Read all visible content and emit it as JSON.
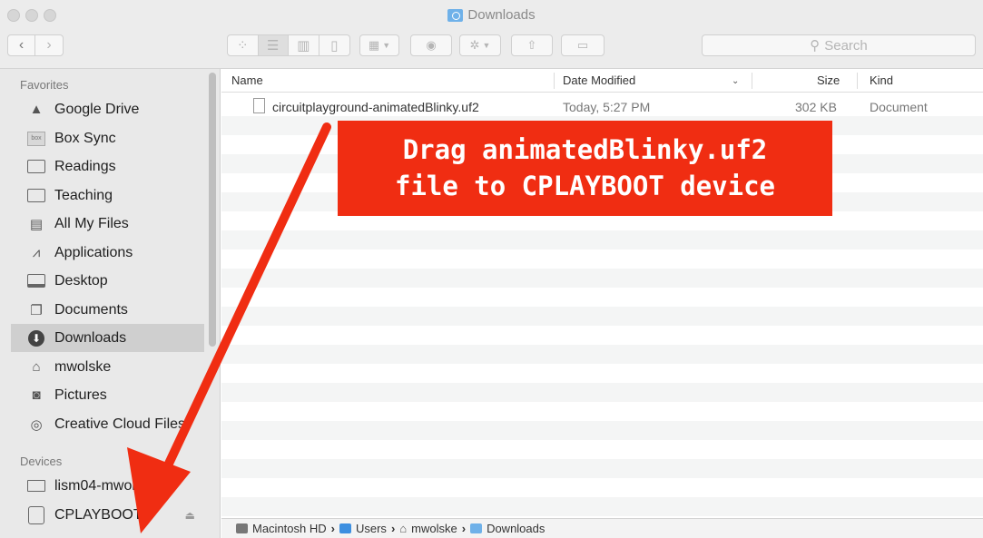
{
  "window": {
    "title": "Downloads"
  },
  "toolbar": {
    "back_icon": "chevron-left-icon",
    "forward_icon": "chevron-right-icon",
    "search_placeholder": "Search"
  },
  "sidebar": {
    "favorites_label": "Favorites",
    "favorites": [
      {
        "label": "Google Drive",
        "icon": "google-drive-icon"
      },
      {
        "label": "Box Sync",
        "icon": "box-icon"
      },
      {
        "label": "Readings",
        "icon": "folder-icon"
      },
      {
        "label": "Teaching",
        "icon": "folder-icon"
      },
      {
        "label": "All My Files",
        "icon": "all-files-icon"
      },
      {
        "label": "Applications",
        "icon": "applications-icon"
      },
      {
        "label": "Desktop",
        "icon": "desktop-icon"
      },
      {
        "label": "Documents",
        "icon": "documents-icon"
      },
      {
        "label": "Downloads",
        "icon": "downloads-icon",
        "selected": true
      },
      {
        "label": "mwolske",
        "icon": "home-icon"
      },
      {
        "label": "Pictures",
        "icon": "camera-icon"
      },
      {
        "label": "Creative Cloud Files",
        "icon": "creative-cloud-icon"
      }
    ],
    "devices_label": "Devices",
    "devices": [
      {
        "label": "lism04-mwolske",
        "icon": "laptop-icon"
      },
      {
        "label": "CPLAYBOOT",
        "icon": "drive-icon",
        "ejectable": true
      }
    ]
  },
  "list": {
    "columns": {
      "name": "Name",
      "date": "Date Modified",
      "size": "Size",
      "kind": "Kind"
    },
    "rows": [
      {
        "name": "circuitplayground-animatedBlinky.uf2",
        "date": "Today, 5:27 PM",
        "size": "302 KB",
        "kind": "Document"
      }
    ]
  },
  "pathbar": {
    "segments": [
      "Macintosh HD",
      "Users",
      "mwolske",
      "Downloads"
    ],
    "separator": "›"
  },
  "annotation": {
    "line1": "Drag animatedBlinky.uf2",
    "line2": "file to CPLAYBOOT device",
    "color": "#f02d12"
  }
}
